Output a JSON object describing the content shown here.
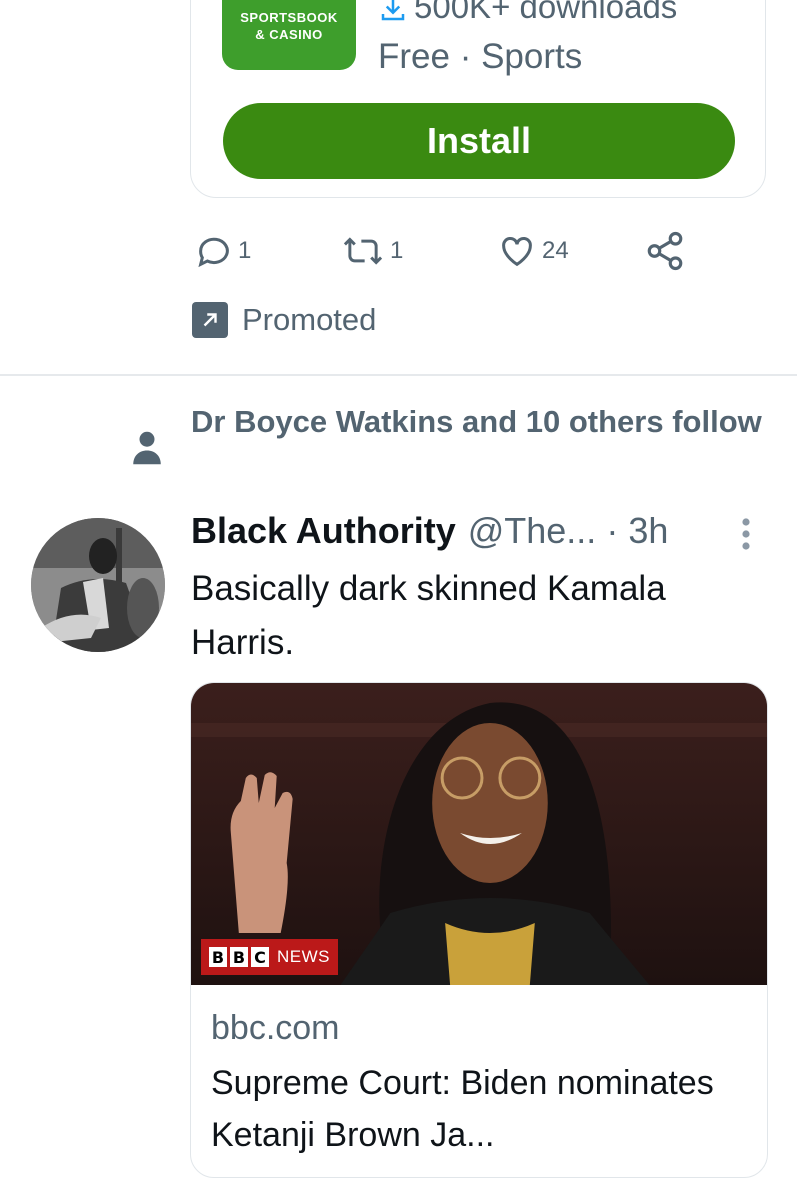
{
  "app_ad": {
    "icon_line1": "SPORTSBOOK",
    "icon_line2": "& CASINO",
    "downloads": "500K+ downloads",
    "meta": "Free · Sports",
    "install_label": "Install"
  },
  "promo_actions": {
    "replies": "1",
    "retweets": "1",
    "likes": "24"
  },
  "promoted_label": "Promoted",
  "social_context": "Dr Boyce Watkins and 10 others follow",
  "tweet": {
    "name": "Black Authority",
    "handle": "@The...",
    "dot": "·",
    "time": "3h",
    "text": "Basically dark skinned Kamala Harris."
  },
  "link_card": {
    "badge_letters": [
      "B",
      "B",
      "C"
    ],
    "badge_news": "NEWS",
    "domain": "bbc.com",
    "title": "Supreme Court: Biden nominates Ketanji Brown Ja..."
  },
  "colors": {
    "install_green": "#3a8a11",
    "app_icon_green": "#3e9e2c",
    "secondary_text": "#536471",
    "bbc_red": "#bb1919"
  }
}
